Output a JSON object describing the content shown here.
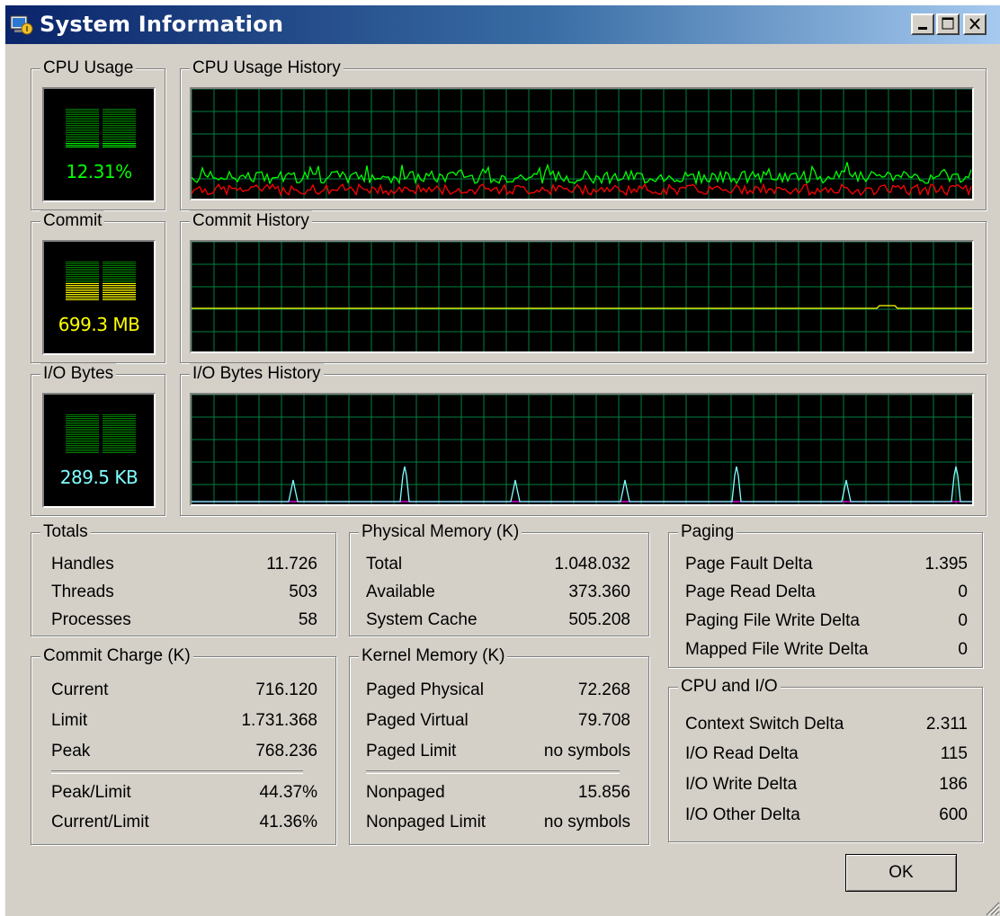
{
  "window": {
    "title": "System Information"
  },
  "colors": {
    "grid": "#008040",
    "cpu_total": "#00ff00",
    "cpu_kernel": "#ff0000",
    "commit": "#ffff00",
    "io_read": "#80ffff",
    "io_write": "#ff00ff",
    "io_value": "#80ffff"
  },
  "icons": {
    "app": "system-info-icon",
    "minimize": "minimize-icon",
    "maximize": "maximize-icon",
    "close": "close-icon"
  },
  "cpu": {
    "label": "CPU Usage",
    "value": "12.31%",
    "percent": 12.31,
    "history_label": "CPU Usage History"
  },
  "commit": {
    "label": "Commit",
    "value": "699.3 MB",
    "fraction": 0.44,
    "history_label": "Commit History"
  },
  "io": {
    "label": "I/O Bytes",
    "value": "289.5  KB",
    "history_label": "I/O Bytes History"
  },
  "totals": {
    "label": "Totals",
    "rows": [
      {
        "label": "Handles",
        "value": "11.726"
      },
      {
        "label": "Threads",
        "value": "503"
      },
      {
        "label": "Processes",
        "value": "58"
      }
    ]
  },
  "commit_charge": {
    "label": "Commit Charge (K)",
    "rows": [
      {
        "label": "Current",
        "value": "716.120"
      },
      {
        "label": "Limit",
        "value": "1.731.368"
      },
      {
        "label": "Peak",
        "value": "768.236"
      },
      {
        "label": "Peak/Limit",
        "value": "44.37%"
      },
      {
        "label": "Current/Limit",
        "value": "41.36%"
      }
    ]
  },
  "physical_memory": {
    "label": "Physical Memory (K)",
    "rows": [
      {
        "label": "Total",
        "value": "1.048.032"
      },
      {
        "label": "Available",
        "value": "373.360"
      },
      {
        "label": "System Cache",
        "value": "505.208"
      }
    ]
  },
  "kernel_memory": {
    "label": "Kernel Memory (K)",
    "rows": [
      {
        "label": "Paged Physical",
        "value": "72.268"
      },
      {
        "label": "Paged Virtual",
        "value": "79.708"
      },
      {
        "label": "Paged Limit",
        "value": "no symbols"
      },
      {
        "label": "Nonpaged",
        "value": "15.856"
      },
      {
        "label": "Nonpaged Limit",
        "value": "no symbols"
      }
    ]
  },
  "paging": {
    "label": "Paging",
    "rows": [
      {
        "label": "Page Fault Delta",
        "value": "1.395"
      },
      {
        "label": "Page Read Delta",
        "value": "0"
      },
      {
        "label": "Paging File Write Delta",
        "value": "0"
      },
      {
        "label": "Mapped File Write Delta",
        "value": "0"
      }
    ]
  },
  "cpu_io": {
    "label": "CPU and I/O",
    "rows": [
      {
        "label": "Context Switch Delta",
        "value": "2.311"
      },
      {
        "label": "I/O Read Delta",
        "value": "115"
      },
      {
        "label": "I/O Write Delta",
        "value": "186"
      },
      {
        "label": "I/O Other Delta",
        "value": "600"
      }
    ]
  },
  "buttons": {
    "ok": "OK"
  }
}
